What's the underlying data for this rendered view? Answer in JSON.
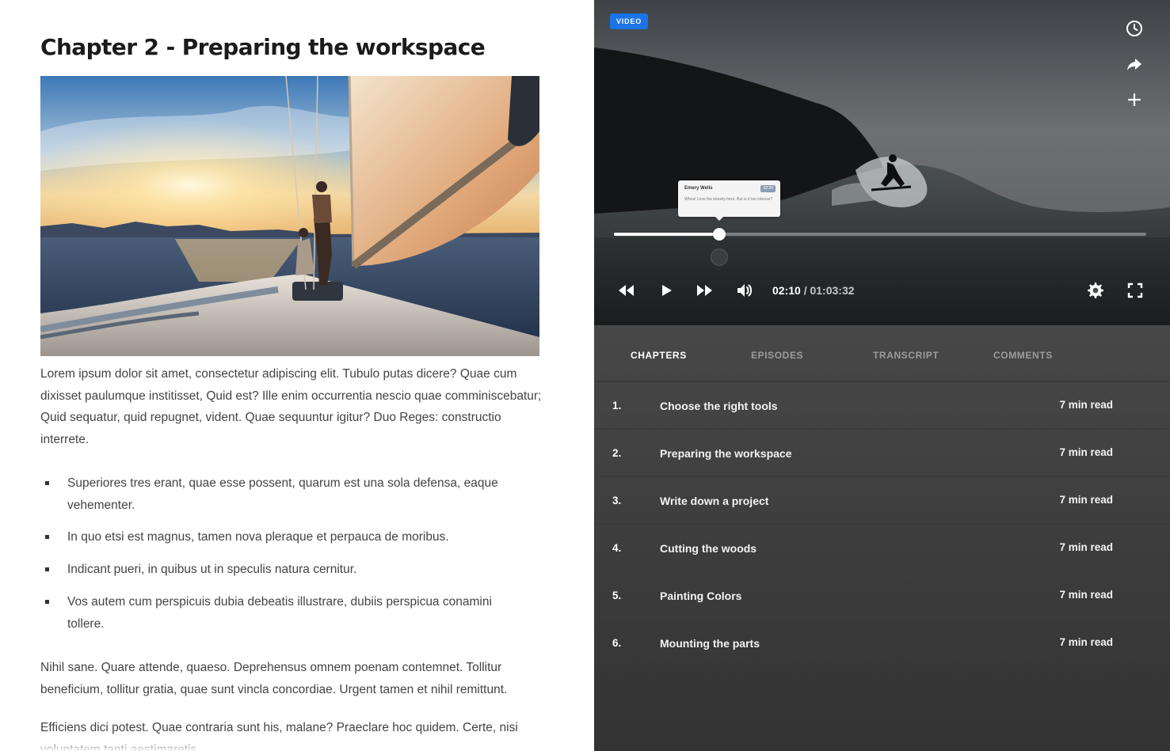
{
  "article": {
    "title": "Chapter 2 - Preparing the workspace",
    "hero_image": "sailboat-at-sunset-photo",
    "paragraph1": "Lorem ipsum dolor sit amet, consectetur adipiscing elit. Tubulo putas dicere? Quae cum dixisset paulumque institisset, Quid est? Ille enim occurrentia nescio quae comminiscebatur; Quid sequatur, quid repugnet, vident. Quae sequuntur igitur? Duo Reges: constructio interrete.",
    "bullets": [
      "Superiores tres erant, quae esse possent, quarum est una sola defensa, eaque vehementer.",
      "In quo etsi est magnus, tamen nova pleraque et perpauca de moribus.",
      "Indicant pueri, in quibus ut in speculis natura cernitur.",
      "Vos autem cum perspicuis dubia debeatis illustrare, dubiis perspicua conamini tollere."
    ],
    "paragraph2": "Nihil sane. Quare attende, quaeso. Deprehensus omnem poenam contemnet. Tollitur beneficium, tollitur gratia, quae sunt vincla concordiae. Urgent tamen et nihil remittunt.",
    "paragraph3": "Efficiens dici potest. Quae contraria sunt his, malane? Praeclare hoc quidem. Certe, nisi voluptatem tanti aestimaretis."
  },
  "player": {
    "badge": "VIDEO",
    "side_icons": [
      "clock-icon",
      "share-icon",
      "plus-icon"
    ],
    "comment": {
      "author": "Emery Wells",
      "timestamp": "02:20",
      "text": "Whoa! Love the intesity here. But is it too intense?"
    },
    "progress_fraction": 0.198,
    "current_time": "02:10",
    "separator": "/",
    "duration": "01:03:32",
    "controls": [
      "rewind-icon",
      "play-icon",
      "fast-forward-icon",
      "volume-icon",
      "settings-gear-icon",
      "fullscreen-icon"
    ],
    "accent_color": "#1a73e8"
  },
  "tabs": [
    {
      "label": "CHAPTERS",
      "active": true
    },
    {
      "label": "EPISODES",
      "active": false
    },
    {
      "label": "TRANSCRIPT",
      "active": false
    },
    {
      "label": "COMMENTS",
      "active": false
    }
  ],
  "chapters": [
    {
      "num": "1.",
      "title": "Choose the right tools",
      "duration": "7 min read"
    },
    {
      "num": "2.",
      "title": "Preparing the workspace",
      "duration": "7 min read"
    },
    {
      "num": "3.",
      "title": "Write down a project",
      "duration": "7 min read"
    },
    {
      "num": "4.",
      "title": "Cutting the woods",
      "duration": "7 min read"
    },
    {
      "num": "5.",
      "title": "Painting Colors",
      "duration": "7 min read"
    },
    {
      "num": "6.",
      "title": "Mounting the parts",
      "duration": "7 min read"
    }
  ]
}
